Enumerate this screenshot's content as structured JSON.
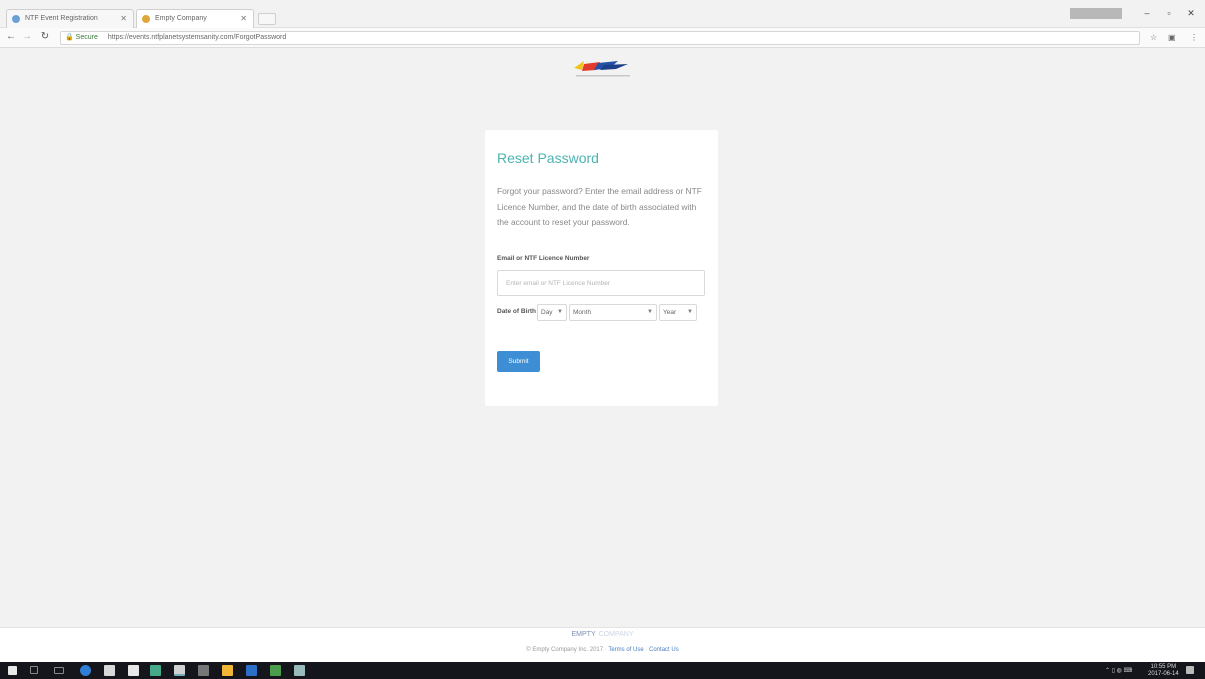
{
  "browser": {
    "tabs": [
      {
        "label": "NTF Event Registration"
      },
      {
        "label": "Empty Company"
      }
    ],
    "address": {
      "secure_label": "Secure",
      "url": "https://events.ntfplanetsystemsanity.com/ForgotPassword"
    }
  },
  "page": {
    "title": "Reset Password",
    "description": "Forgot your password? Enter the email address or NTF Licence Number, and the date of birth associated with the account to reset your password.",
    "email_label": "Email or NTF Licence Number",
    "email_placeholder": "Enter email or NTF Licence Number",
    "dob_label": "Date of Birth",
    "day_value": "Day",
    "month_value": "Month",
    "year_value": "Year",
    "submit_label": "Submit"
  },
  "footer": {
    "brand": "EMPTY",
    "brand_suffix": "COMPANY",
    "copyright": "© Empty Company Inc. 2017 ·",
    "terms": "Terms of Use",
    "separator": " · ",
    "contact": "Contact Us"
  },
  "taskbar": {
    "time": "10:55 PM",
    "date": "2017-06-14"
  }
}
